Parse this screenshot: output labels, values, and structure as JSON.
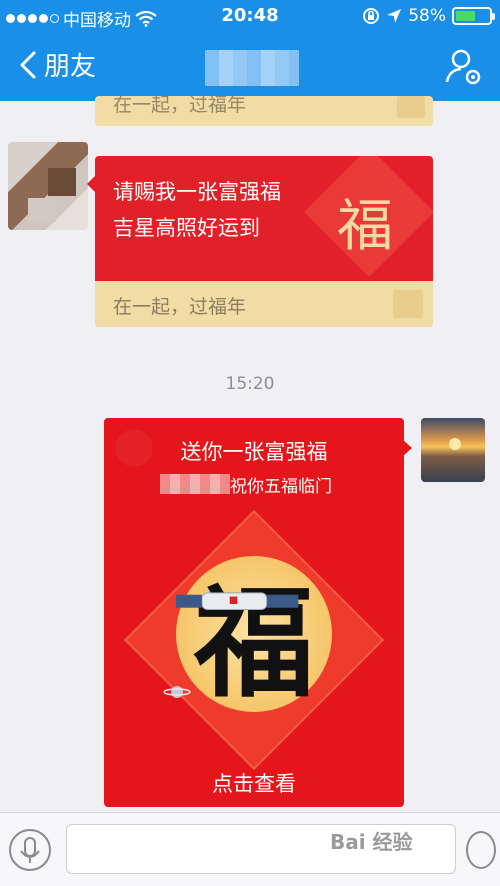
{
  "status_bar": {
    "carrier": "中国移动",
    "time": "20:48",
    "battery_percent": "58%",
    "battery_level": 0.58
  },
  "nav": {
    "back_label": "朋友",
    "profile_icon": "user-settings-icon"
  },
  "messages": [
    {
      "partial_footer": "在一起，过福年"
    },
    {
      "line1": "请赐我一张富强福",
      "line2": "吉星高照好运到",
      "fu_char": "福",
      "footer": "在一起，过福年"
    }
  ],
  "timestamp": "15:20",
  "big_card": {
    "title": "送你一张富强福",
    "subtitle": "祝你五福临门",
    "fu_char": "福",
    "action": "点击查看"
  },
  "watermark": "Bai 经验",
  "colors": {
    "nav_blue": "#1a8fe8",
    "card_red": "#e2202a",
    "card_footer": "#f2dca6",
    "chat_bg": "#efeff4"
  }
}
